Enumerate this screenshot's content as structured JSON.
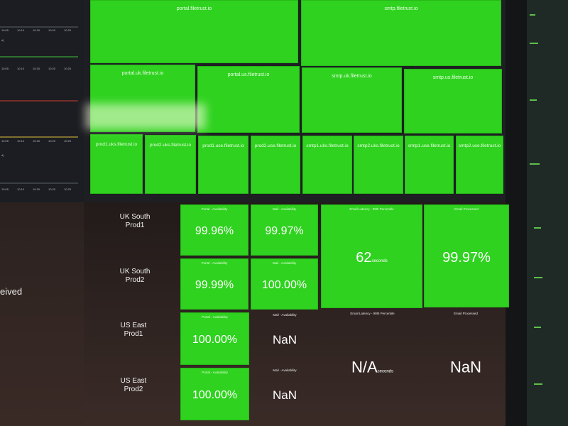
{
  "top_tiles": [
    {
      "id": "portal-filetrust",
      "label": "portal.filetrust.io"
    },
    {
      "id": "smtp-filetrust",
      "label": "smtp.filetrust.io"
    },
    {
      "id": "portal-uk",
      "label": "portal.uk.filetrust.io"
    },
    {
      "id": "portal-us",
      "label": "portal.us.filetrust.io"
    },
    {
      "id": "smtp-uk",
      "label": "smtp.uk.filetrust.io"
    },
    {
      "id": "smtp-us",
      "label": "smtp.us.filetrust.io"
    },
    {
      "id": "prod1-uks",
      "label": "prod1.uks.filetrust.io"
    },
    {
      "id": "prod2-uks",
      "label": "prod2.uks.filetrust.io"
    },
    {
      "id": "prod1-use",
      "label": "prod1.use.filetrust.io"
    },
    {
      "id": "prod2-use",
      "label": "prod2.use.filetrust.io"
    },
    {
      "id": "smtp1-uks",
      "label": "smtp1.uks.filetrust.io"
    },
    {
      "id": "smtp2-uks",
      "label": "smtp2.uks.filetrust.io"
    },
    {
      "id": "smtp1-use",
      "label": "smtp1.use.filetrust.io"
    },
    {
      "id": "smtp2-use",
      "label": "smtp2.use.filetrust.io"
    }
  ],
  "rows": {
    "uk_south_prod1": {
      "line1": "UK South",
      "line2": "Prod1"
    },
    "uk_south_prod2": {
      "line1": "UK South",
      "line2": "Prod2"
    },
    "us_east_prod1": {
      "line1": "US East",
      "line2": "Prod1"
    },
    "us_east_prod2": {
      "line1": "US East",
      "line2": "Prod2"
    }
  },
  "stats": {
    "uks1_portal": {
      "title": "Portal - Availability",
      "value": "99.96%"
    },
    "uks1_mail": {
      "title": "Mail - Availability",
      "value": "99.97%"
    },
    "uks2_portal": {
      "title": "Portal - Availability",
      "value": "99.99%"
    },
    "uks2_mail": {
      "title": "Mail - Availability",
      "value": "100.00%"
    },
    "use1_portal": {
      "title": "Portal - Availability",
      "value": "100.00%"
    },
    "use1_mail": {
      "title": "Mail - Availability",
      "value": "NaN"
    },
    "use2_portal": {
      "title": "Portal - Availability",
      "value": "100.00%"
    },
    "use2_mail": {
      "title": "Mail - Availability",
      "value": "NaN"
    },
    "uk_latency": {
      "title": "Email Latency - 99th Percentile",
      "value": "62",
      "unit": "seconds"
    },
    "uk_processed": {
      "title": "Email Processed",
      "value": "99.97%"
    },
    "us_latency": {
      "title": "Email Latency - 99th Percentile",
      "value": "N/A",
      "unit": "seconds"
    },
    "us_processed": {
      "title": "Email Processed",
      "value": "NaN"
    }
  },
  "left_panel": {
    "cut_label": "eived",
    "axis_ticks": [
      "10:05",
      "10:10",
      "10:15",
      "10:20",
      "10:25"
    ],
    "legend_fragments": [
      "d)",
      "d)"
    ]
  }
}
